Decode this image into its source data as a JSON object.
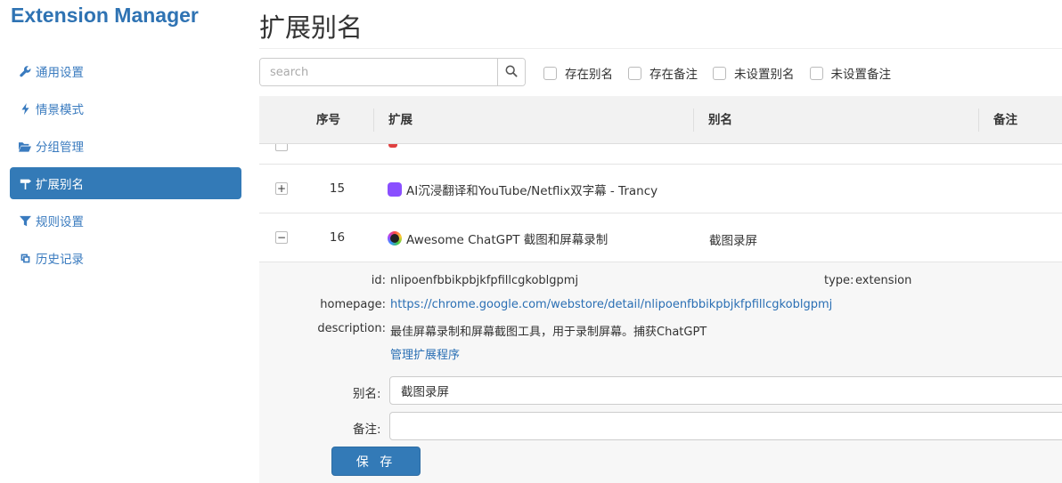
{
  "brand": "Extension Manager",
  "nav": [
    {
      "label": "通用设置",
      "icon": "wrench-icon"
    },
    {
      "label": "情景模式",
      "icon": "lightning-icon"
    },
    {
      "label": "分组管理",
      "icon": "folder-open-icon"
    },
    {
      "label": "扩展别名",
      "icon": "signpost-icon",
      "active": true
    },
    {
      "label": "规则设置",
      "icon": "filter-icon"
    },
    {
      "label": "历史记录",
      "icon": "history-icon"
    }
  ],
  "page_title": "扩展别名",
  "search": {
    "placeholder": "search"
  },
  "filters": [
    "存在别名",
    "存在备注",
    "未设置别名",
    "未设置备注"
  ],
  "table": {
    "headers": [
      "序号",
      "扩展",
      "别名",
      "备注"
    ],
    "rows": [
      {
        "toggle": "+",
        "index": "15",
        "name": "AI沉浸翻译和YouTube/Netflix双字幕 - Trancy",
        "alias": "",
        "icon_color": "#8a4fff"
      },
      {
        "toggle": "−",
        "index": "16",
        "name": "Awesome ChatGPT 截图和屏幕录制",
        "alias": "截图录屏",
        "icon_color": "#222222"
      }
    ]
  },
  "details": {
    "id_label": "id:",
    "id": "nlipoenfbbikpbjkfpfillcgkoblgpmj",
    "type_label": "type:",
    "type": "extension",
    "homepage_label": "homepage:",
    "homepage": "https://chrome.google.com/webstore/detail/nlipoenfbbikpbjkfpfillcgkoblgpmj",
    "description_label": "description:",
    "description": "最佳屏幕录制和屏幕截图工具，用于录制屏幕。捕获ChatGPT",
    "manage_link": "管理扩展程序",
    "alias_label": "别名:",
    "alias_value": "截图录屏",
    "note_label": "备注:",
    "note_value": "",
    "save_label": "保 存"
  }
}
